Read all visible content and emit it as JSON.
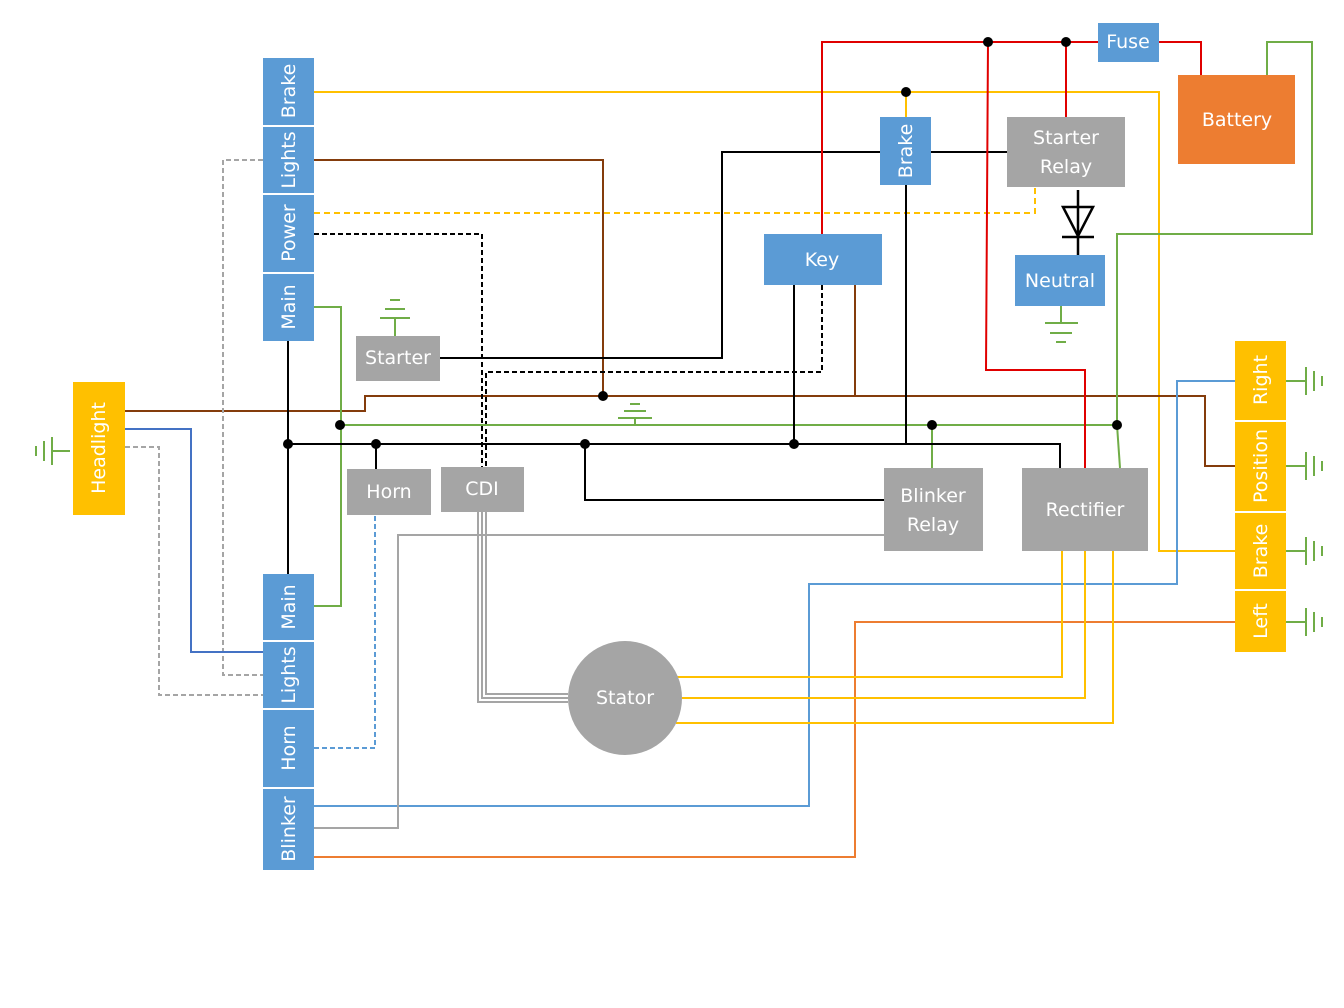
{
  "colors": {
    "blue_box": "#5B9BD5",
    "gray_box": "#A5A5A5",
    "yellow_box": "#FFC000",
    "orange_box": "#ED7D31",
    "red": "#E00000",
    "yellow": "#FFC000",
    "brown": "#843C0C",
    "green": "#70AD47",
    "black": "#000000",
    "wire_blue": "#5B9BD5",
    "wire_orange": "#ED7D31",
    "wire_gray": "#A5A5A5"
  },
  "left_top_connector": [
    "Brake",
    "Lights",
    "Power",
    "Main"
  ],
  "left_bottom_connector": [
    "Main",
    "Lights",
    "Horn",
    "Blinker"
  ],
  "right_connector": [
    "Right",
    "Position",
    "Brake",
    "Left"
  ],
  "components": {
    "headlight": "Headlight",
    "starter": "Starter",
    "horn": "Horn",
    "cdi": "CDI",
    "brake": "Brake",
    "starter_relay_1": "Starter",
    "starter_relay_2": "Relay",
    "key": "Key",
    "neutral": "Neutral",
    "fuse": "Fuse",
    "battery": "Battery",
    "blinker_relay_1": "Blinker",
    "blinker_relay_2": "Relay",
    "rectifier": "Rectifier",
    "stator": "Stator"
  },
  "symbols": [
    "diode-icon",
    "ground-icon"
  ]
}
